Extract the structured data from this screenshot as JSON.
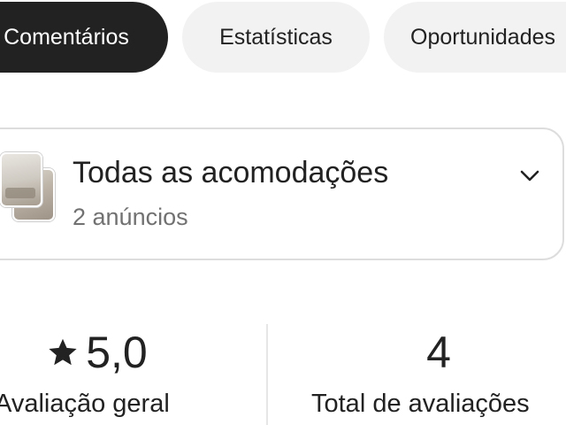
{
  "tabs": [
    {
      "label": "Comentários",
      "active": true
    },
    {
      "label": "Estatísticas",
      "active": false
    },
    {
      "label": "Oportunidades",
      "active": false
    }
  ],
  "listing_selector": {
    "title": "Todas as acomodações",
    "subtitle": "2 anúncios",
    "icon": "chevron-down-icon"
  },
  "stats": {
    "overall_rating": {
      "value": "5,0",
      "label": "Avaliação geral",
      "icon": "star-icon"
    },
    "total_reviews": {
      "value": "4",
      "label": "Total de avaliações"
    }
  },
  "colors": {
    "active_tab_bg": "#222222",
    "inactive_tab_bg": "#f2f2f2",
    "text_primary": "#222222",
    "text_secondary": "#717171",
    "border": "#dddddd"
  }
}
